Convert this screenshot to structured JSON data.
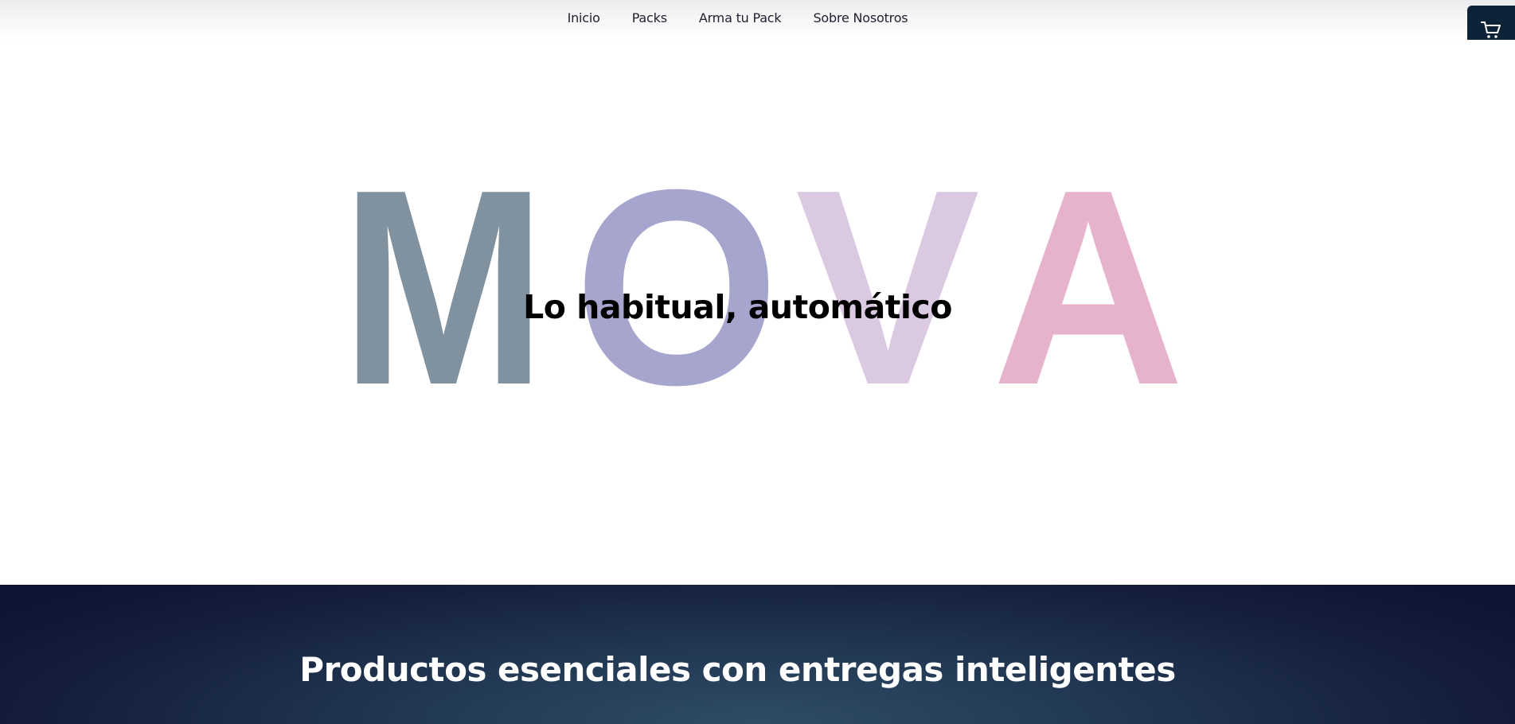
{
  "nav": {
    "items": [
      {
        "label": "Inicio"
      },
      {
        "label": "Packs"
      },
      {
        "label": "Arma tu Pack"
      },
      {
        "label": "Sobre Nosotros"
      }
    ]
  },
  "cart": {
    "icon": "shopping-cart-icon",
    "color": "#0d2438"
  },
  "hero": {
    "logo_text": "MOVA",
    "logo_letters": [
      {
        "char": "M",
        "color": "#80919f"
      },
      {
        "char": "O",
        "color": "#a6a5ce"
      },
      {
        "char": "V",
        "color": "#dbc9e2"
      },
      {
        "char": "A",
        "color": "#e7b2cb"
      }
    ],
    "tagline": "Lo habitual, automático"
  },
  "band": {
    "title": "Productos esenciales con entregas inteligentes"
  }
}
